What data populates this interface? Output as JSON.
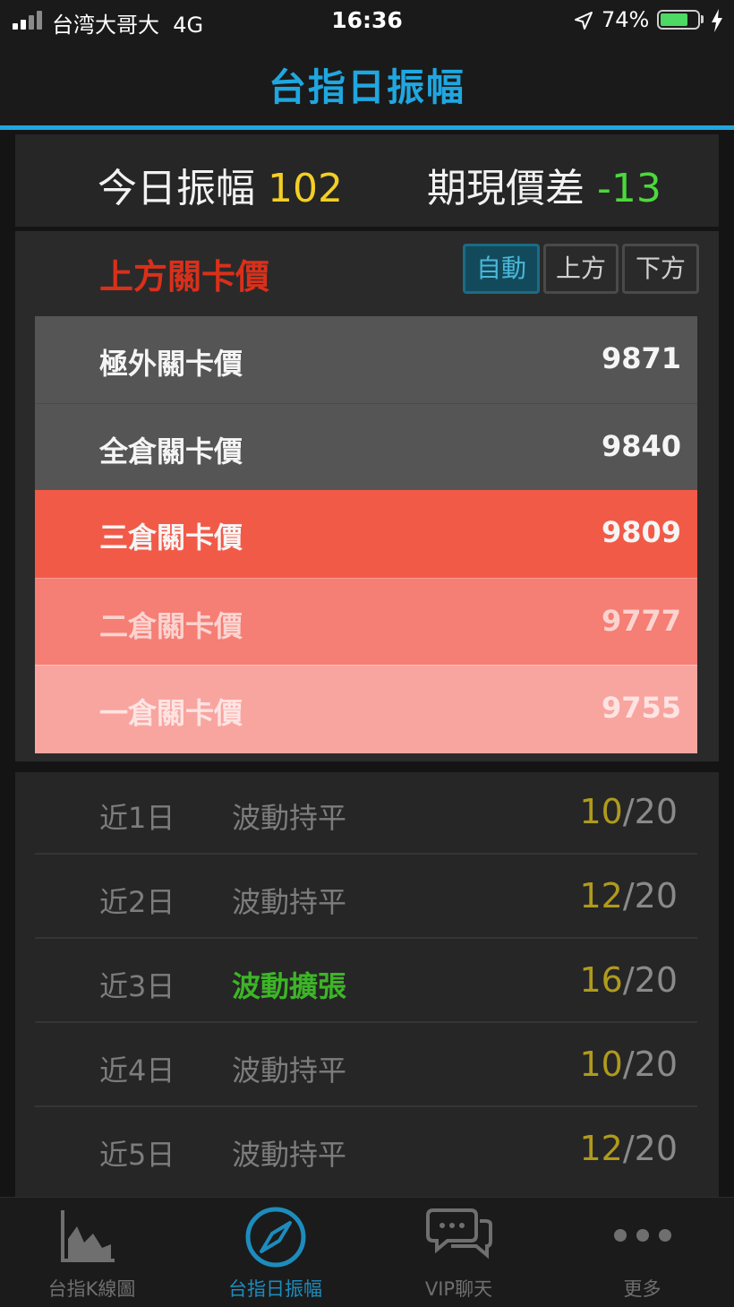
{
  "status_bar": {
    "carrier": "台湾大哥大",
    "network": "4G",
    "time": "16:36",
    "battery_percent": "74%",
    "battery_level": 0.74
  },
  "header": {
    "title": "台指日振幅"
  },
  "summary": {
    "amplitude_label": "今日振幅",
    "amplitude_value": "102",
    "basis_label": "期現價差",
    "basis_value": "-13"
  },
  "levels_panel": {
    "title": "上方關卡價",
    "segments": [
      "自動",
      "上方",
      "下方"
    ],
    "active_segment": "自動",
    "levels": [
      {
        "label": "極外關卡價",
        "value": "9871"
      },
      {
        "label": "全倉關卡價",
        "value": "9840"
      },
      {
        "label": "三倉關卡價",
        "value": "9809"
      },
      {
        "label": "二倉關卡價",
        "value": "9777"
      },
      {
        "label": "一倉關卡價",
        "value": "9755"
      }
    ]
  },
  "history": [
    {
      "day": "近1日",
      "state": "波動持平",
      "score": "10",
      "total": "/20"
    },
    {
      "day": "近2日",
      "state": "波動持平",
      "score": "12",
      "total": "/20"
    },
    {
      "day": "近3日",
      "state": "波動擴張",
      "score": "16",
      "total": "/20"
    },
    {
      "day": "近4日",
      "state": "波動持平",
      "score": "10",
      "total": "/20"
    },
    {
      "day": "近5日",
      "state": "波動持平",
      "score": "12",
      "total": "/20"
    }
  ],
  "tab_bar": {
    "tabs": [
      {
        "label": "台指K線圖",
        "icon": "chart-icon"
      },
      {
        "label": "台指日振幅",
        "icon": "compass-icon"
      },
      {
        "label": "VIP聊天",
        "icon": "chat-icon"
      },
      {
        "label": "更多",
        "icon": "more-icon"
      }
    ],
    "active_index": 1
  },
  "colors": {
    "accent": "#1fa7e0",
    "amplitude_value": "#f3cf25",
    "basis_value": "#4bd83c",
    "panel_title": "#d9301a",
    "level_dark": "#555555",
    "level_red_1": "#f25a48",
    "level_red_2": "#f57e75",
    "level_red_3": "#f8a5a0"
  }
}
